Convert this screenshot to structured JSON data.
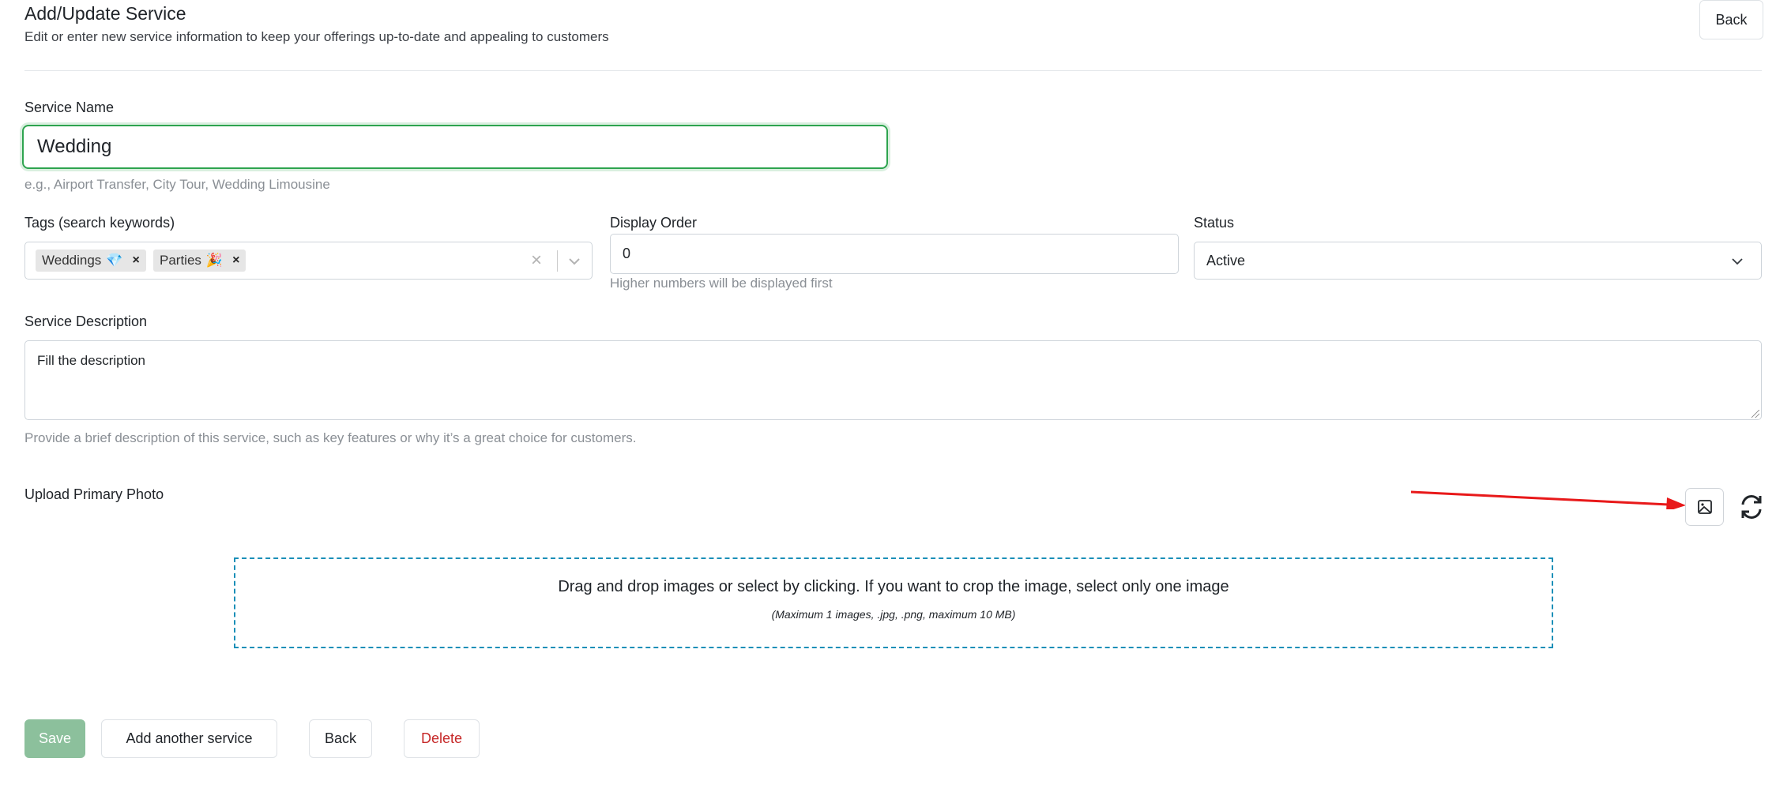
{
  "header": {
    "title": "Add/Update Service",
    "subtitle": "Edit or enter new service information to keep your offerings up-to-date and appealing to customers",
    "back_label": "Back"
  },
  "service_name": {
    "label": "Service Name",
    "value": "Wedding",
    "help": "e.g., Airport Transfer, City Tour, Wedding Limousine"
  },
  "tags": {
    "label": "Tags (search keywords)",
    "items": [
      {
        "label": "Weddings",
        "emoji": "💎",
        "remove": "×"
      },
      {
        "label": "Parties",
        "emoji": "🎉",
        "remove": "×"
      }
    ],
    "clear": "×"
  },
  "display_order": {
    "label": "Display Order",
    "value": "0",
    "help": "Higher numbers will be displayed first"
  },
  "status": {
    "label": "Status",
    "selected": "Active"
  },
  "description": {
    "label": "Service Description",
    "value": "Fill the description",
    "help": "Provide a brief description of this service, such as key features or why it’s a great choice for customers."
  },
  "upload": {
    "label": "Upload Primary Photo",
    "dropzone_text": "Drag and drop images or select by clicking. If you want to crop the image, select only one image",
    "dropzone_hint": "(Maximum 1 images, .jpg, .png, maximum 10 MB)"
  },
  "annotation": {
    "arrow_color": "#e8191a"
  },
  "footer": {
    "save_label": "Save",
    "add_another_label": "Add another service",
    "back_label": "Back",
    "delete_label": "Delete"
  },
  "colors": {
    "accent_green": "#2ea44f",
    "save_disabled": "#8cc09c",
    "danger": "#c62828",
    "dropzone_border": "#1a8fb8"
  }
}
